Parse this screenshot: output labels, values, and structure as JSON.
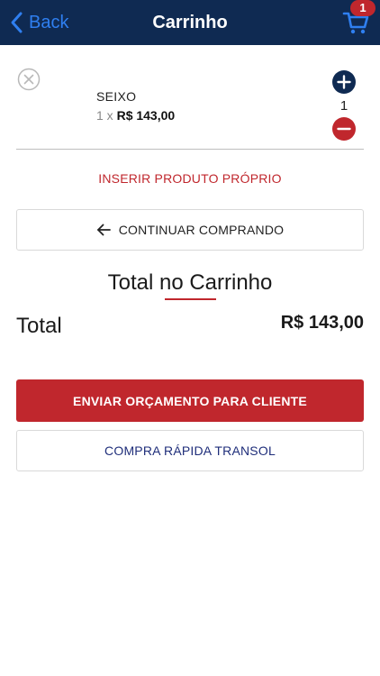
{
  "colors": {
    "navbar": "#0f2a52",
    "back_link": "#2f7ff0",
    "accent_red": "#c0272d",
    "transol_blue": "#1f2e7a"
  },
  "navbar": {
    "back_label": "Back",
    "title": "Carrinho",
    "cart_icon": "cart-icon",
    "cart_badge": "1"
  },
  "cart": {
    "items": [
      {
        "name": "SEIXO",
        "qty_prefix": "1 x",
        "price": "R$ 143,00",
        "quantity": "1"
      }
    ]
  },
  "actions": {
    "insert_own_product": "INSERIR PRODUTO PRÓPRIO",
    "continue_shopping": "CONTINUAR COMPRANDO",
    "send_quote": "ENVIAR ORÇAMENTO PARA CLIENTE",
    "quick_purchase": "COMPRA RÁPIDA TRANSOL"
  },
  "totals": {
    "heading": "Total no Carrinho",
    "label": "Total",
    "value": "R$ 143,00"
  }
}
